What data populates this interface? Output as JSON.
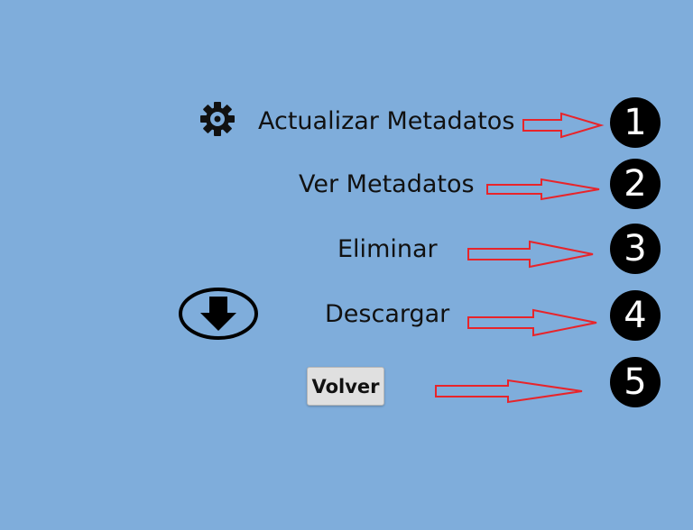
{
  "menu": {
    "items": [
      {
        "label": "Actualizar Metadatos",
        "icon": "gear-icon"
      },
      {
        "label": "Ver Metadatos"
      },
      {
        "label": "Eliminar"
      },
      {
        "label": "Descargar",
        "icon": "download-icon"
      }
    ]
  },
  "volver": {
    "label": "Volver"
  },
  "callouts": [
    "1",
    "2",
    "3",
    "4",
    "5"
  ],
  "colors": {
    "background": "#7faddb",
    "arrow_stroke": "#e8242a",
    "badge_fill": "#000000",
    "badge_text": "#ffffff",
    "button_bg": "#e0e0e0"
  }
}
